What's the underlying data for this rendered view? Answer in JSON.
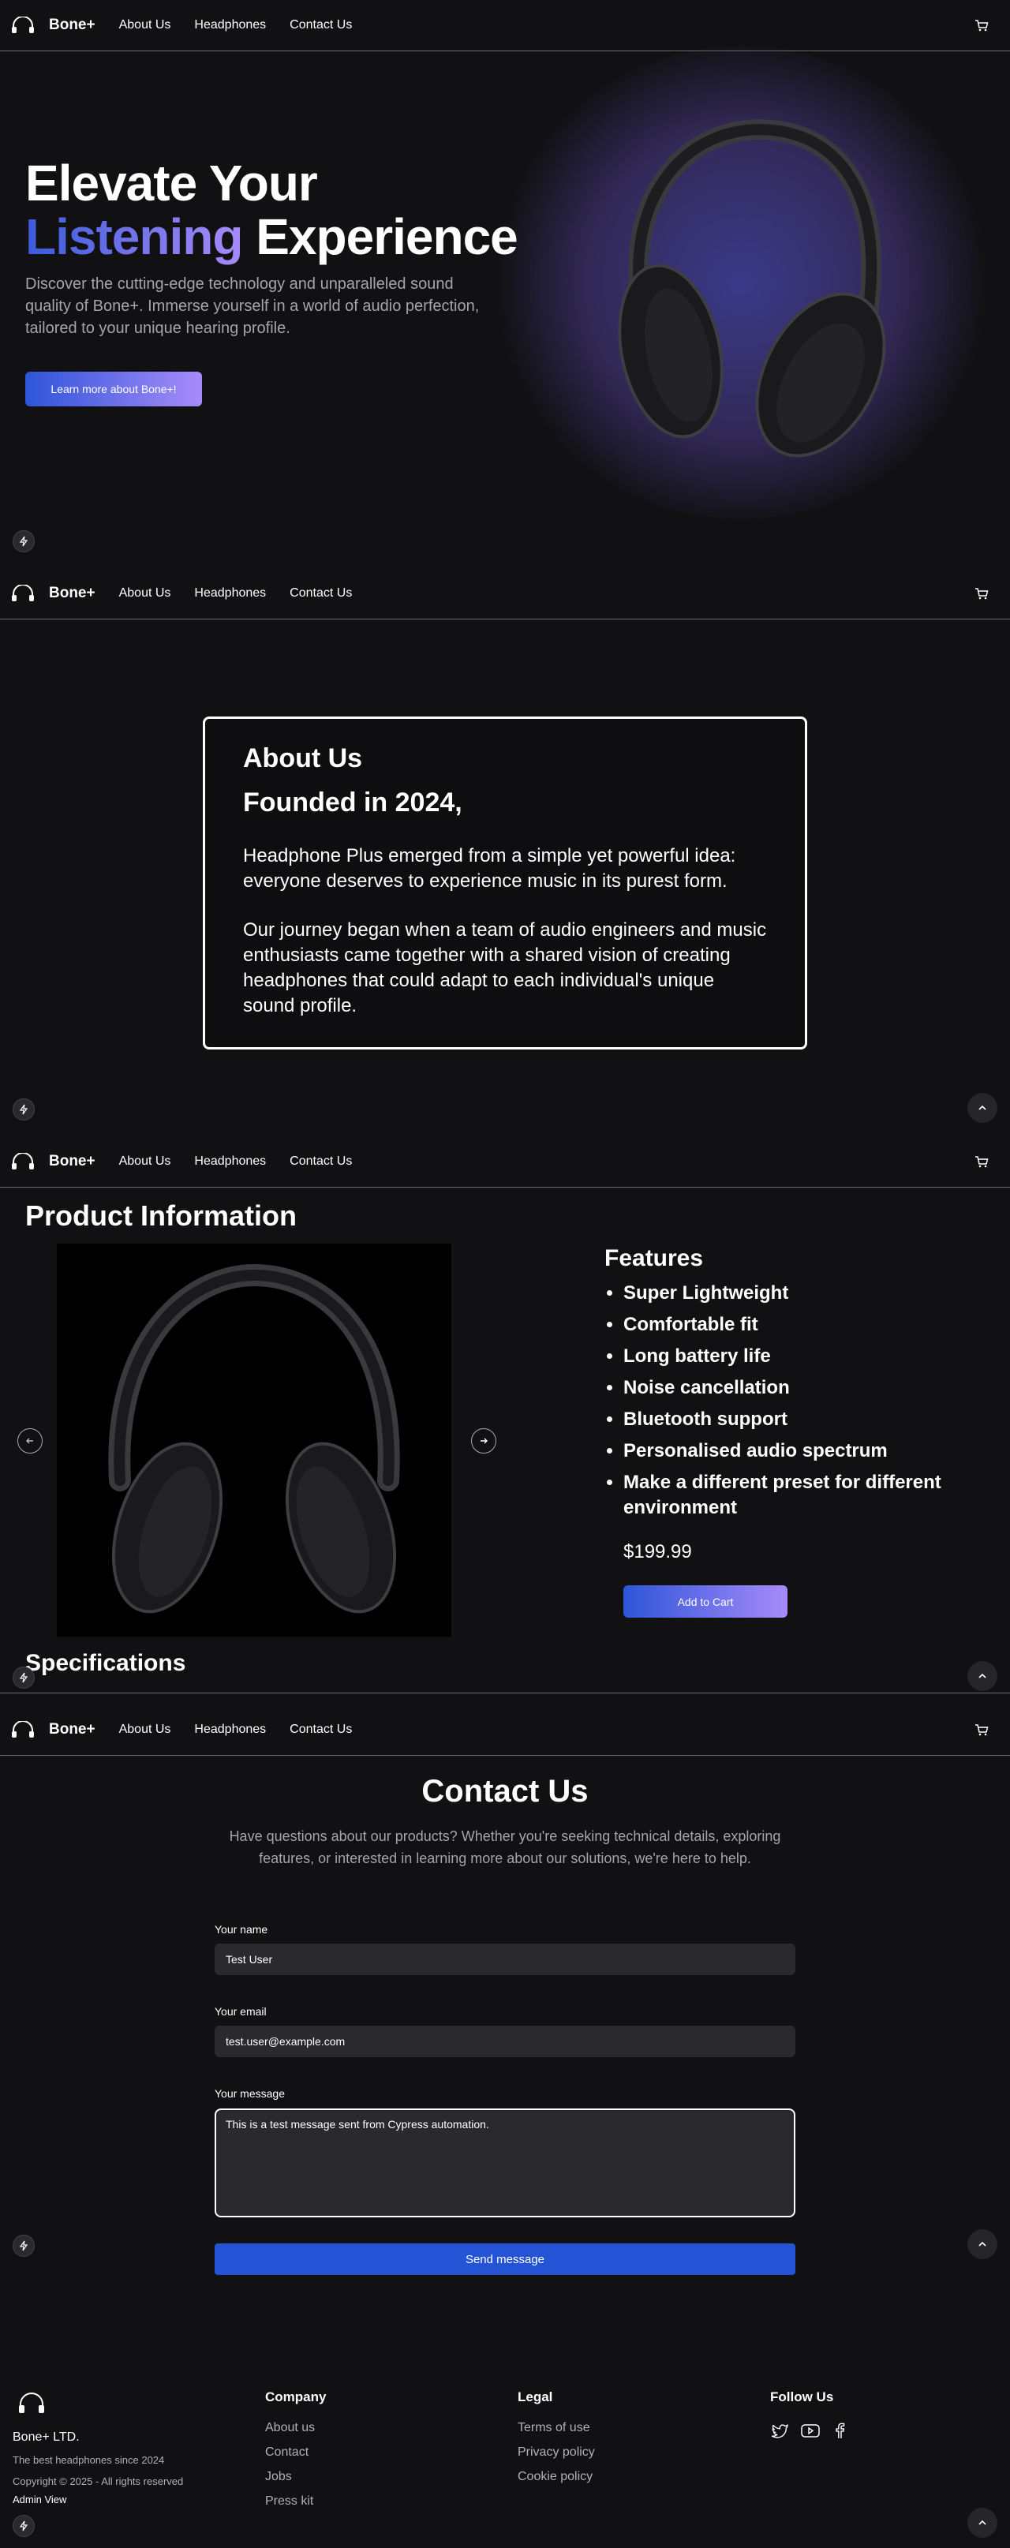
{
  "nav": {
    "brand": "Bone+",
    "links": [
      "About Us",
      "Headphones",
      "Contact Us"
    ]
  },
  "hero": {
    "title_line1": "Elevate Your",
    "title_highlight": "Listening",
    "title_rest": " Experience",
    "description": "Discover the cutting-edge technology and unparalleled sound quality of Bone+. Immerse yourself in a world of audio perfection, tailored to your unique hearing profile.",
    "cta_label": "Learn more about Bone+!"
  },
  "about": {
    "heading": "About Us",
    "subheading": "Founded in 2024,",
    "paragraph1": "Headphone Plus emerged from a simple yet powerful idea: everyone deserves to experience music in its purest form.",
    "paragraph2": "Our journey began when a team of audio engineers and music enthusiasts came together with a shared vision of creating headphones that could adapt to each individual's unique sound profile."
  },
  "product": {
    "heading": "Product Information",
    "features_heading": "Features",
    "features": [
      "Super Lightweight",
      "Comfortable fit",
      "Long battery life",
      "Noise cancellation",
      "Bluetooth support",
      "Personalised audio spectrum",
      "Make a different preset for different environment"
    ],
    "price": "$199.99",
    "add_to_cart_label": "Add to Cart",
    "specs_heading": "Specifications"
  },
  "contact": {
    "heading": "Contact Us",
    "lead": "Have questions about our products? Whether you're seeking technical details, exploring features, or interested in learning more about our solutions, we're here to help.",
    "name_label": "Your name",
    "name_value": "Test User",
    "email_label": "Your email",
    "email_value": "test.user@example.com",
    "message_label": "Your message",
    "message_value": "This is a test message sent from Cypress automation.",
    "send_label": "Send message"
  },
  "footer": {
    "company_name": "Bone+ LTD.",
    "tagline": "The best headphones since 2024",
    "copyright": "Copyright © 2025 - All rights reserved",
    "admin_link": "Admin View",
    "company_heading": "Company",
    "company_links": [
      "About us",
      "Contact",
      "Jobs",
      "Press kit"
    ],
    "legal_heading": "Legal",
    "legal_links": [
      "Terms of use",
      "Privacy policy",
      "Cookie policy"
    ],
    "follow_heading": "Follow Us",
    "social_icons": [
      "twitter-icon",
      "youtube-icon",
      "facebook-icon"
    ]
  },
  "colors": {
    "accent_start": "#2e55d8",
    "accent_end": "#a78bfa",
    "background": "#111113",
    "send_button": "#2453d6"
  }
}
